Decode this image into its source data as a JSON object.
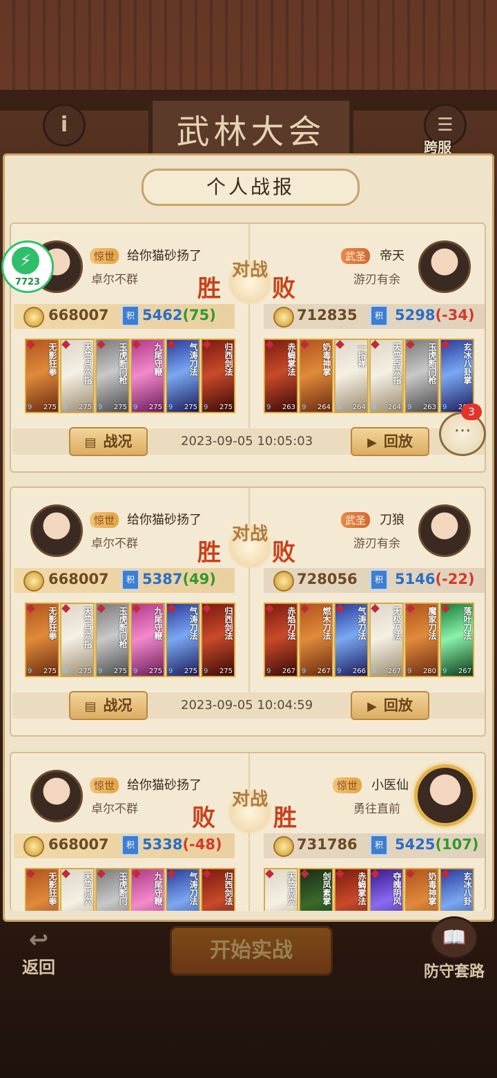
{
  "header": {
    "title": "武林大会",
    "info_icon": "info-icon",
    "cross_label": "跨服"
  },
  "panel": {
    "title": "个人战报"
  },
  "vs_text": "对战",
  "records": [
    {
      "left": {
        "rank": "惊世",
        "name": "给你猫砂扬了",
        "guild": "卓尔不群",
        "result": "胜",
        "power": "668007",
        "score": "5462",
        "delta": "(75)",
        "cards": [
          {
            "name": "无影狂拳",
            "lv": "275"
          },
          {
            "name": "天竺点穴指",
            "lv": "275"
          },
          {
            "name": "玉虎断门枪",
            "lv": "275"
          },
          {
            "name": "九尾守鞭",
            "lv": "275"
          },
          {
            "name": "气涛刀法",
            "lv": "275"
          },
          {
            "name": "归西剑法",
            "lv": "275"
          }
        ]
      },
      "right": {
        "rank": "武圣",
        "name": "帝天",
        "guild": "游刃有余",
        "result": "败",
        "power": "712835",
        "score": "5298",
        "delta": "(-34)",
        "cards": [
          {
            "name": "赤蝎掌法",
            "lv": "263"
          },
          {
            "name": "奶毒神掌",
            "lv": "264"
          },
          {
            "name": "一指禅",
            "lv": "264"
          },
          {
            "name": "天竺点穴指",
            "lv": "264"
          },
          {
            "name": "玉虎断门枪",
            "lv": "263"
          },
          {
            "name": "玄冰八卦掌",
            "lv": "263"
          }
        ]
      },
      "btn_report": "战况",
      "btn_replay": "回放",
      "time": "2023-09-05 10:05:03"
    },
    {
      "left": {
        "rank": "惊世",
        "name": "给你猫砂扬了",
        "guild": "卓尔不群",
        "result": "胜",
        "power": "668007",
        "score": "5387",
        "delta": "(49)",
        "cards": [
          {
            "name": "无影狂拳",
            "lv": "275"
          },
          {
            "name": "天竺点穴指",
            "lv": "275"
          },
          {
            "name": "玉虎断门枪",
            "lv": "275"
          },
          {
            "name": "九尾守鞭",
            "lv": "275"
          },
          {
            "name": "气涛刀法",
            "lv": "275"
          },
          {
            "name": "归西剑法",
            "lv": "275"
          }
        ]
      },
      "right": {
        "rank": "武圣",
        "name": "刀狼",
        "guild": "游刃有余",
        "result": "败",
        "power": "728056",
        "score": "5146",
        "delta": "(-22)",
        "cards": [
          {
            "name": "赤焰刀法",
            "lv": "267"
          },
          {
            "name": "燃木刀法",
            "lv": "267"
          },
          {
            "name": "气涛刀法",
            "lv": "266"
          },
          {
            "name": "无极刀法",
            "lv": "267"
          },
          {
            "name": "魔家刀法",
            "lv": "280"
          },
          {
            "name": "落叶刀法",
            "lv": "267"
          }
        ]
      },
      "btn_report": "战况",
      "btn_replay": "回放",
      "time": "2023-09-05 10:04:59"
    },
    {
      "left": {
        "rank": "惊世",
        "name": "给你猫砂扬了",
        "guild": "卓尔不群",
        "result": "败",
        "power": "668007",
        "score": "5338",
        "delta": "(-48)",
        "cards": [
          {
            "name": "无影狂拳",
            "lv": ""
          },
          {
            "name": "天竺点穴",
            "lv": ""
          },
          {
            "name": "玉虎断门",
            "lv": ""
          },
          {
            "name": "九尾守鞭",
            "lv": ""
          },
          {
            "name": "气涛刀法",
            "lv": ""
          },
          {
            "name": "归西剑法",
            "lv": ""
          }
        ]
      },
      "right": {
        "rank": "惊世",
        "name": "小医仙",
        "guild": "勇往直前",
        "result": "胜",
        "power": "731786",
        "score": "5425",
        "delta": "(107)",
        "cards": [
          {
            "name": "天竺点穴",
            "lv": ""
          },
          {
            "name": "剑凤素掌",
            "lv": ""
          },
          {
            "name": "赤蝎掌法",
            "lv": ""
          },
          {
            "name": "夺魄阴风",
            "lv": ""
          },
          {
            "name": "奶毒神掌",
            "lv": ""
          },
          {
            "name": "玄冰八卦",
            "lv": ""
          }
        ]
      }
    }
  ],
  "chat": {
    "badge": "3"
  },
  "overlay": {
    "label": "7723"
  },
  "bottom": {
    "back": "返回",
    "start": "开始实战",
    "defense": "防守套路"
  }
}
